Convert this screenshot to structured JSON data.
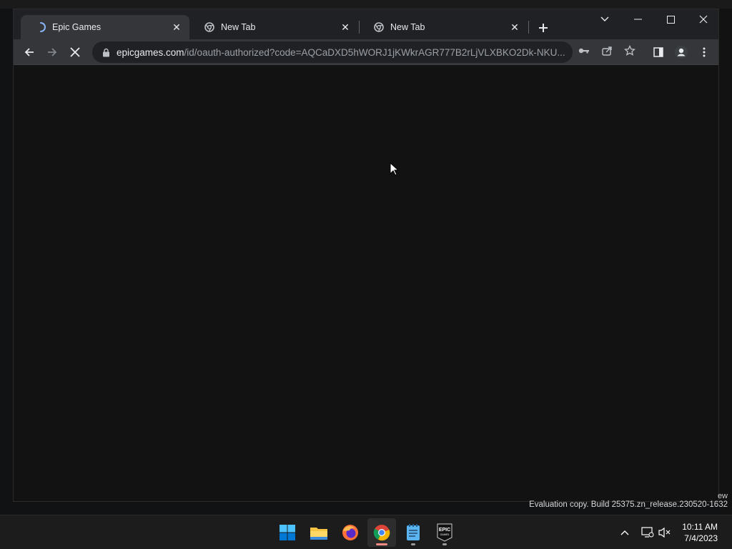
{
  "browser": {
    "tabs": [
      {
        "title": "Epic Games",
        "active": true,
        "loading": true
      },
      {
        "title": "New Tab",
        "active": false
      },
      {
        "title": "New Tab",
        "active": false
      }
    ],
    "address": {
      "host": "epicgames.com",
      "path": "/id/oauth-authorized?code=AQCaDXD5hWORJ1jKWkrAGR777B2rLjVLXBKO2Dk-NKU..."
    }
  },
  "os": {
    "watermark_fragment": "ew",
    "watermark": "Evaluation copy. Build 25375.zn_release.230520-1632",
    "clock": {
      "time": "10:11 AM",
      "date": "7/4/2023"
    },
    "taskbar_apps": [
      "start-button",
      "file-explorer",
      "firefox",
      "chrome",
      "notepad",
      "epic-games-launcher"
    ]
  },
  "colors": {
    "accent_loading": "#8ab4f8",
    "active_indicator": "#f28b82"
  }
}
